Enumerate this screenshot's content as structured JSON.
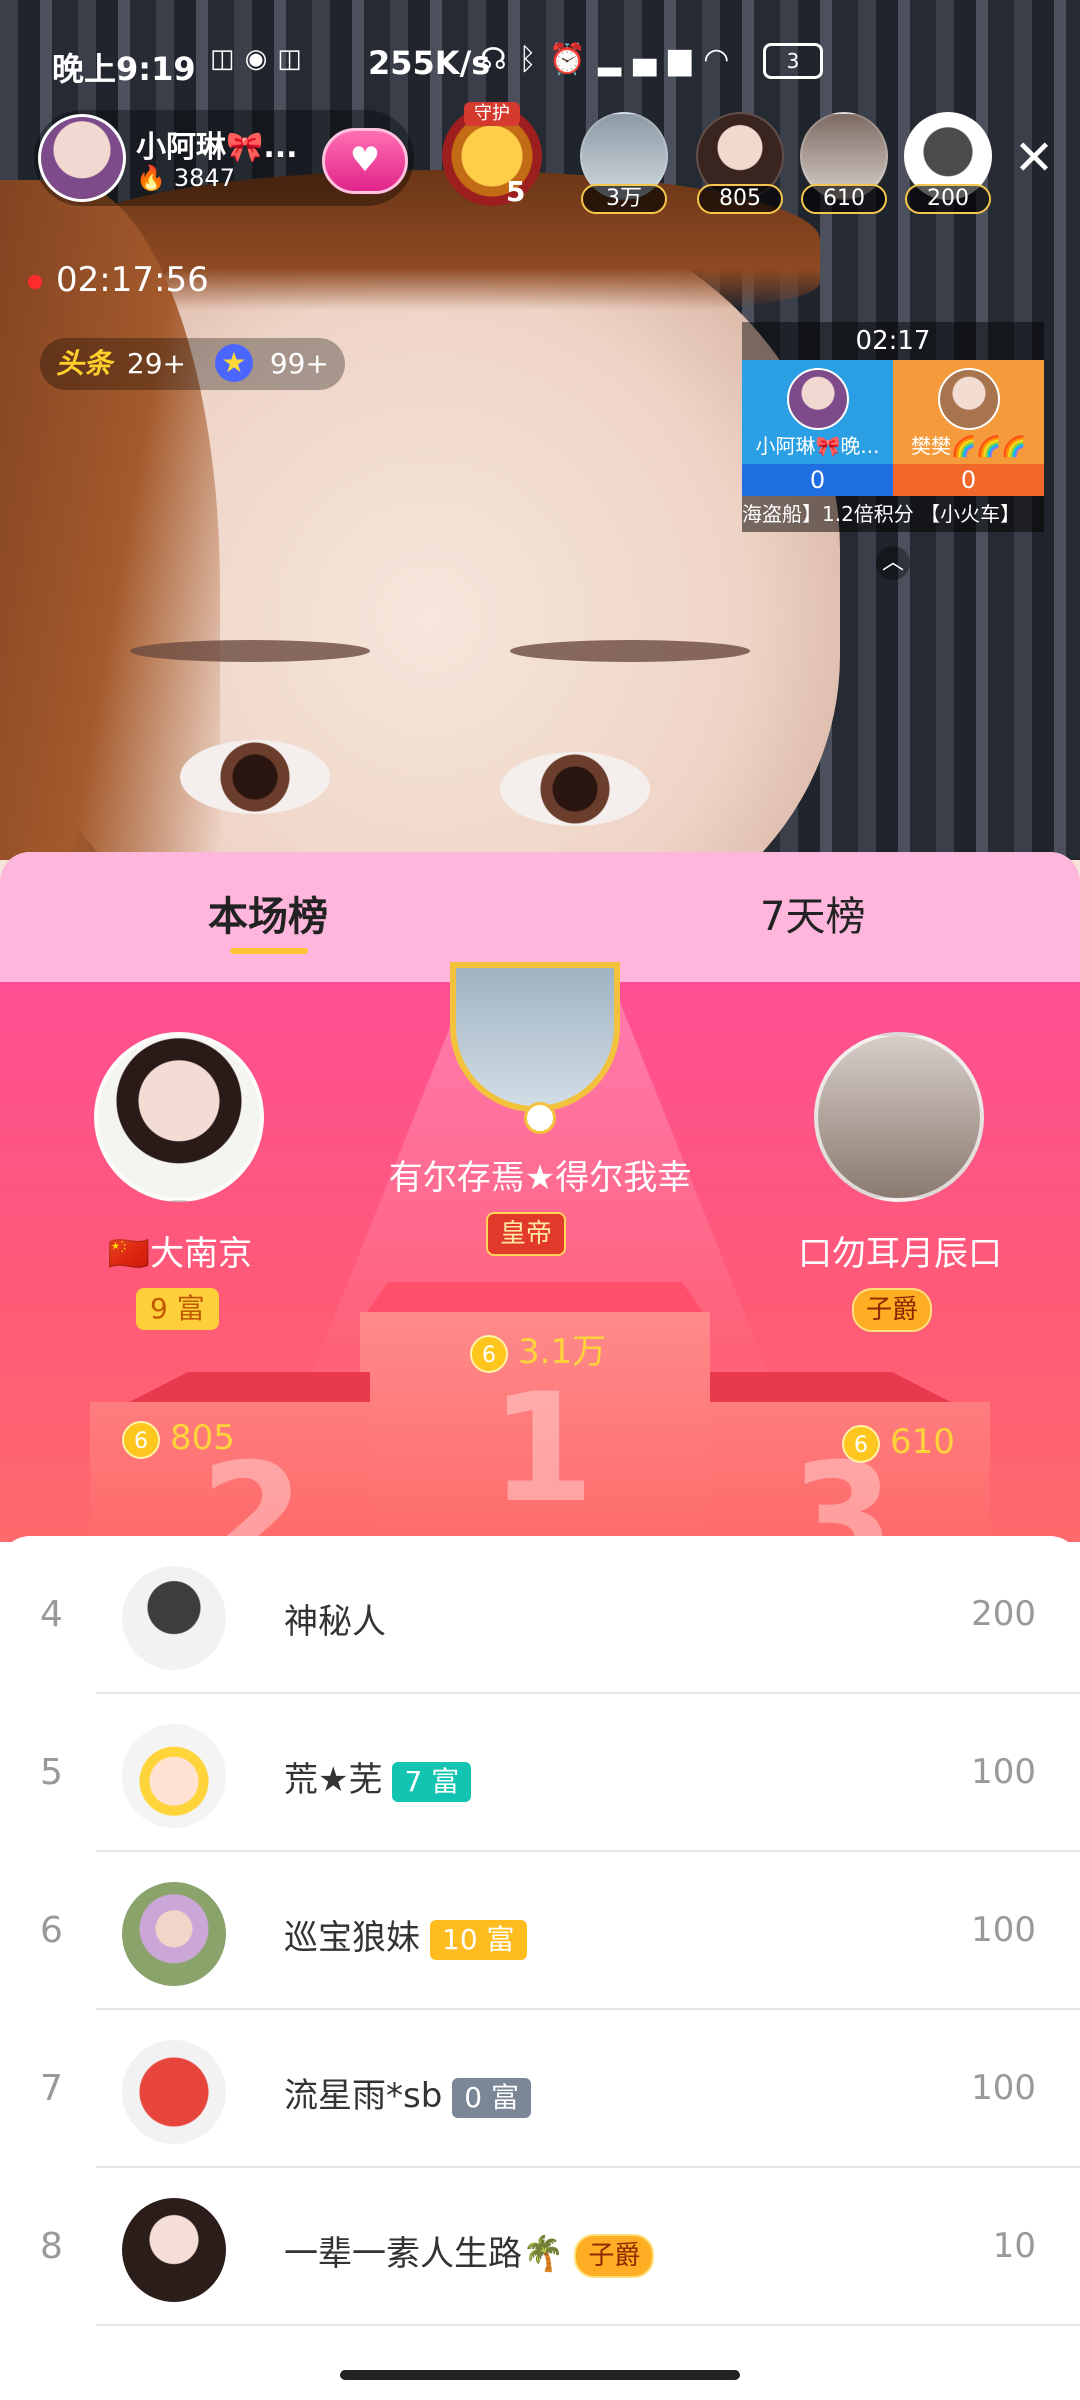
{
  "status": {
    "time": "晚上9:19",
    "net_speed": "255K/s",
    "battery": "3"
  },
  "header": {
    "host_name": "小阿琳🎀...",
    "host_score": "3847",
    "guard_label": "守护",
    "guard_level": "5",
    "viewers": [
      {
        "count": "3万"
      },
      {
        "count": "805"
      },
      {
        "count": "610"
      },
      {
        "count": "200"
      }
    ],
    "live_duration": "02:17:56",
    "headline_count": "29+",
    "star_count": "99+"
  },
  "pk": {
    "timer": "02:17",
    "left_name": "小阿琳🎀晚...",
    "right_name": "樊樊🌈🌈🌈",
    "left_score": "0",
    "right_score": "0",
    "ticker": "海盗船】1.2倍积分    【小火车】"
  },
  "ranking": {
    "tabs": [
      "本场榜",
      "7天榜"
    ],
    "first": {
      "name": "有尔存焉★得尔我幸",
      "title": "皇帝",
      "value": "3.1万"
    },
    "second": {
      "name": "🇨🇳大南京",
      "rich": "9 富",
      "value": "805"
    },
    "third": {
      "name": "口勿耳月辰口",
      "title": "子爵",
      "value": "610"
    },
    "rows": [
      {
        "rank": "4",
        "name": "神秘人",
        "badge": "",
        "value": "200"
      },
      {
        "rank": "5",
        "name": "荒★芜",
        "badge": "7 富",
        "value": "100"
      },
      {
        "rank": "6",
        "name": "巡宝狼妹",
        "badge": "10 富",
        "value": "100"
      },
      {
        "rank": "7",
        "name": "流星雨*sb",
        "badge": "0 富",
        "value": "100"
      },
      {
        "rank": "8",
        "name": "一辈一素人生路🌴",
        "badge": "子爵",
        "value": "10"
      }
    ]
  }
}
